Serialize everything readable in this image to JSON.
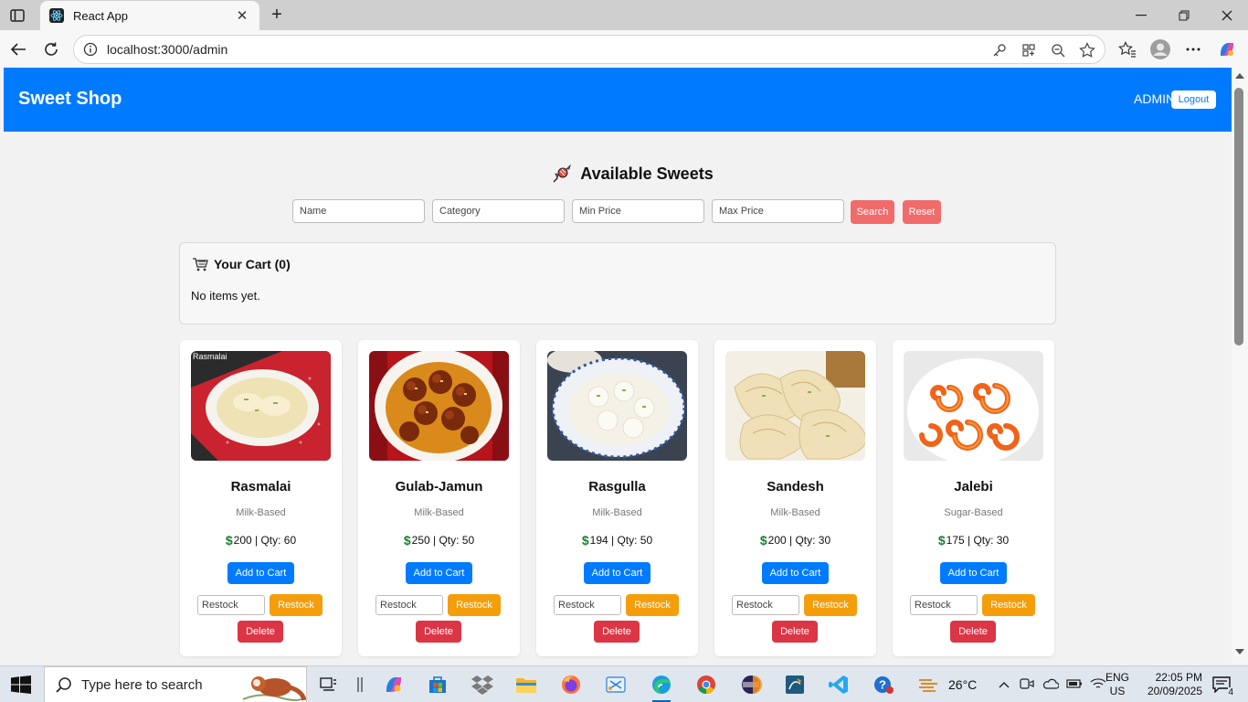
{
  "browser": {
    "tab_title": "React App",
    "url": "localhost:3000/admin"
  },
  "navbar": {
    "brand": "Sweet Shop",
    "role": "ADMIN",
    "logout_label": "Logout",
    "color": "#007bff"
  },
  "page": {
    "title": "Available Sweets",
    "filters": {
      "name_placeholder": "Name",
      "category_placeholder": "Category",
      "min_price_placeholder": "Min Price",
      "max_price_placeholder": "Max Price",
      "search_label": "Search",
      "reset_label": "Reset"
    },
    "cart": {
      "title": "Your Cart (0)",
      "empty_text": "No items yet."
    }
  },
  "sweets": [
    {
      "name": "Rasmalai",
      "category": "Milk-Based",
      "price_qty": "200 | Qty: 60",
      "image_caption": "Rasmalai",
      "add_label": "Add to Cart",
      "restock_placeholder": "Restock",
      "restock_label": "Restock",
      "delete_label": "Delete"
    },
    {
      "name": "Gulab-Jamun",
      "category": "Milk-Based",
      "price_qty": "250 | Qty: 50",
      "add_label": "Add to Cart",
      "restock_placeholder": "Restock",
      "restock_label": "Restock",
      "delete_label": "Delete"
    },
    {
      "name": "Rasgulla",
      "category": "Milk-Based",
      "price_qty": "194 | Qty: 50",
      "add_label": "Add to Cart",
      "restock_placeholder": "Restock",
      "restock_label": "Restock",
      "delete_label": "Delete"
    },
    {
      "name": "Sandesh",
      "category": "Milk-Based",
      "price_qty": "200 | Qty: 30",
      "add_label": "Add to Cart",
      "restock_placeholder": "Restock",
      "restock_label": "Restock",
      "delete_label": "Delete"
    },
    {
      "name": "Jalebi",
      "category": "Sugar-Based",
      "price_qty": "175 | Qty: 30",
      "add_label": "Add to Cart",
      "restock_placeholder": "Restock",
      "restock_label": "Restock",
      "delete_label": "Delete"
    }
  ],
  "taskbar": {
    "search_placeholder": "Type here to search",
    "weather": "26°C",
    "language": "ENG",
    "region": "US",
    "time": "22:05 PM",
    "date": "20/09/2025",
    "notification_count": "4"
  }
}
